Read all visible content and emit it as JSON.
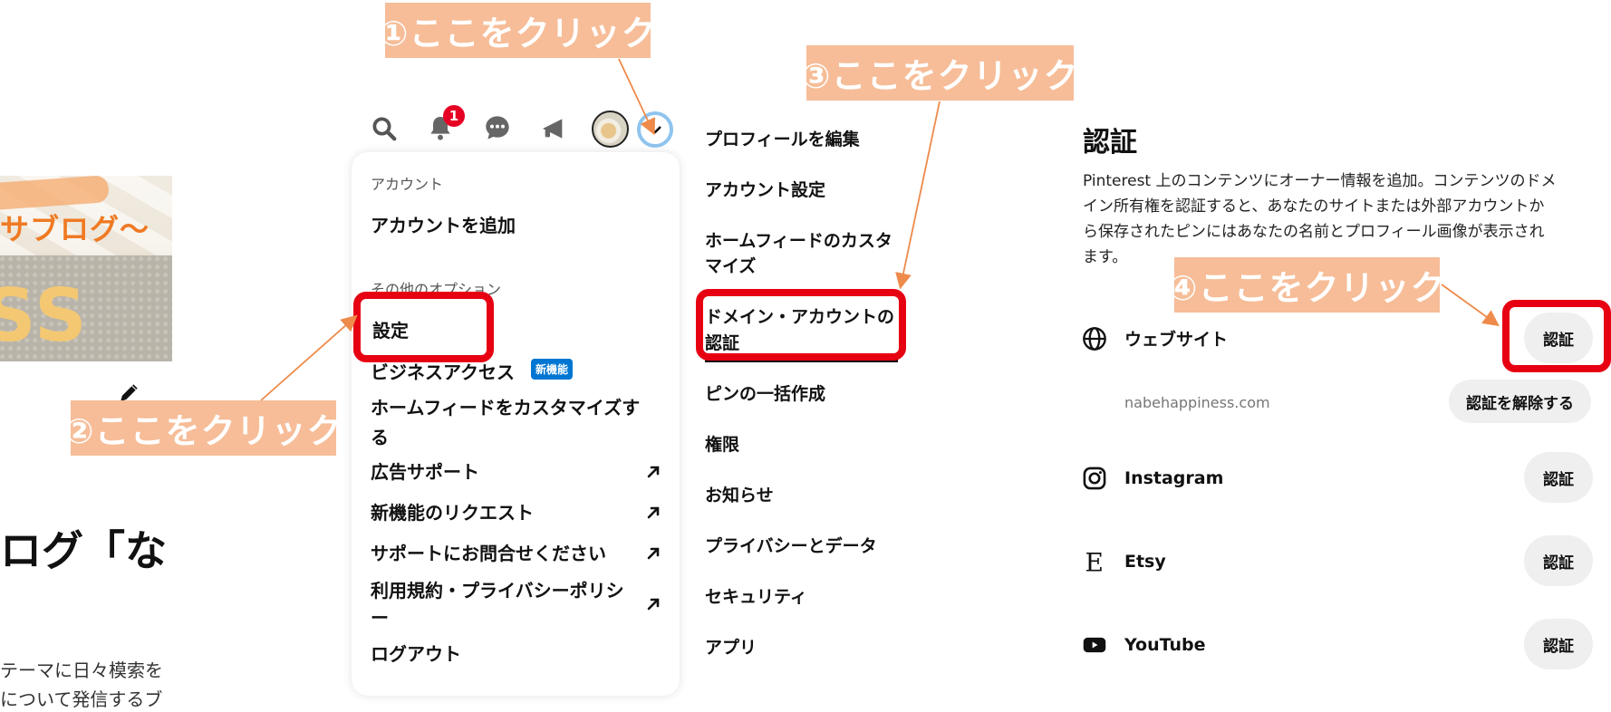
{
  "blog": {
    "banner": "サブログ〜",
    "banner_letters": "SS",
    "heading": "ログ「な",
    "body_line1": "テーマに日々模索を",
    "body_line2": "について発信するブ"
  },
  "callouts": {
    "step1": "①ここをクリック",
    "step2": "②ここをクリック",
    "step3": "③ここをクリック",
    "step4": "④ここをクリック"
  },
  "topbar": {
    "notification_count": "1",
    "icons": [
      "search-icon",
      "bell-icon",
      "chat-icon",
      "megaphone-icon",
      "avatar",
      "chevron-down-icon"
    ]
  },
  "dropdown": {
    "account_header": "アカウント",
    "add_account": "アカウントを追加",
    "other_options_header": "その他のオプション",
    "settings": "設定",
    "business_access": "ビジネスアクセス",
    "new_badge": "新機能",
    "customize_feed_line1": "ホームフィードをカスタマイズす",
    "customize_feed_line2": "る",
    "ad_support": "広告サポート",
    "feature_request": "新機能のリクエスト",
    "contact_support": "サポートにお問合せください",
    "terms_line1": "利用規約・プライバシーポリシ",
    "terms_line2": "ー",
    "logout": "ログアウト"
  },
  "settings_menu": {
    "edit_profile": "プロフィールを編集",
    "account_settings": "アカウント設定",
    "home_feed_line1": "ホームフィードのカスタ",
    "home_feed_line2": "マイズ",
    "claim_line1": "ドメイン・アカウントの",
    "claim_line2": "認証",
    "bulk_create": "ピンの一括作成",
    "permissions": "権限",
    "notifications": "お知らせ",
    "privacy": "プライバシーとデータ",
    "security": "セキュリティ",
    "apps": "アプリ"
  },
  "verification": {
    "title": "認証",
    "desc_line1": "Pinterest 上のコンテンツにオーナー情報を追加。コンテンツのドメ",
    "desc_line2": "イン所有権を認証すると、あなたのサイトまたは外部アカウントか",
    "desc_line3": "ら保存されたピンにはあなたの名前とプロフィール画像が表示され",
    "desc_line4": "ます。",
    "website_label": "ウェブサイト",
    "website_button": "認証",
    "domain": "nabehappiness.com",
    "unclaim_button": "認証を解除する",
    "instagram_label": "Instagram",
    "instagram_button": "認証",
    "etsy_label": "Etsy",
    "etsy_button": "認証",
    "youtube_label": "YouTube",
    "youtube_button": "認証"
  },
  "colors": {
    "callout_bg": "#f6bd98",
    "highlight_red": "#e60012",
    "arrow_orange": "#ee8a4a",
    "badge_red": "#e60023",
    "new_badge_blue": "#0076d3",
    "pill_gray": "#efefef"
  }
}
